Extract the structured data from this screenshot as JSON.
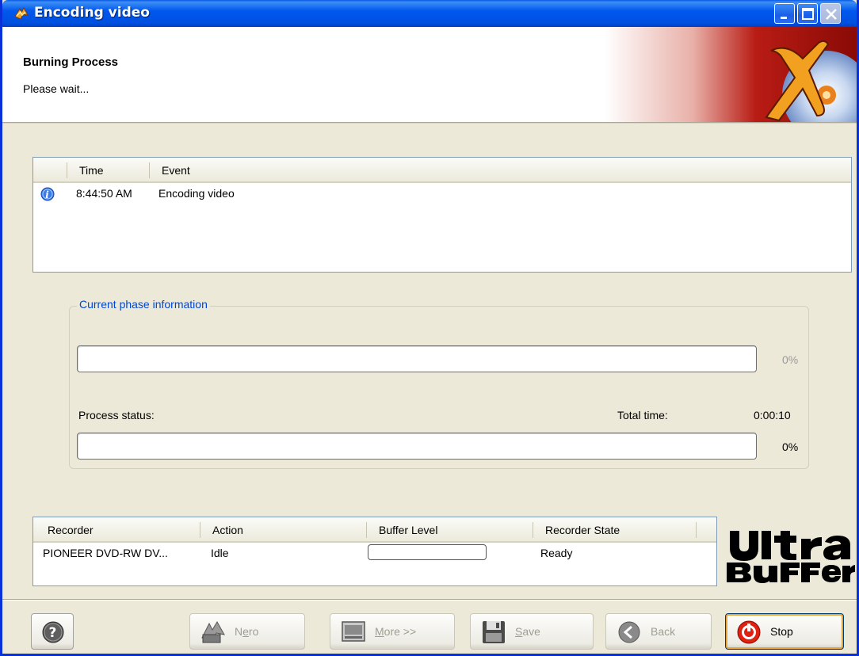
{
  "window": {
    "title": "Encoding video",
    "title_icon": "nero-flame-icon"
  },
  "header": {
    "title": "Burning Process",
    "subtitle": "Please wait..."
  },
  "eventlist": {
    "columns": [
      "Time",
      "Event"
    ],
    "rows": [
      {
        "icon": "info-icon",
        "time": "8:44:50 AM",
        "event": "Encoding video"
      }
    ]
  },
  "phase": {
    "legend": "Current phase information",
    "phase_progress": 0,
    "phase_percent": "0%",
    "status_label": "Process status:",
    "total_time_label": "Total time:",
    "total_time": "0:00:10",
    "process_progress": 0,
    "process_percent": "0%"
  },
  "recorders": {
    "columns": [
      "Recorder",
      "Action",
      "Buffer Level",
      "Recorder State"
    ],
    "rows": [
      {
        "recorder": "PIONEER DVD-RW  DV...",
        "action": "Idle",
        "buffer_level": 0,
        "state": "Ready"
      }
    ]
  },
  "buttons": {
    "help": "help-icon",
    "nero": "Nero",
    "more": "More >>",
    "save": "Save",
    "back": "Back",
    "stop": "Stop"
  },
  "colors": {
    "title_bar": "#0058ee",
    "legend_text": "#0046d5",
    "window_bg": "#ece9d8"
  }
}
